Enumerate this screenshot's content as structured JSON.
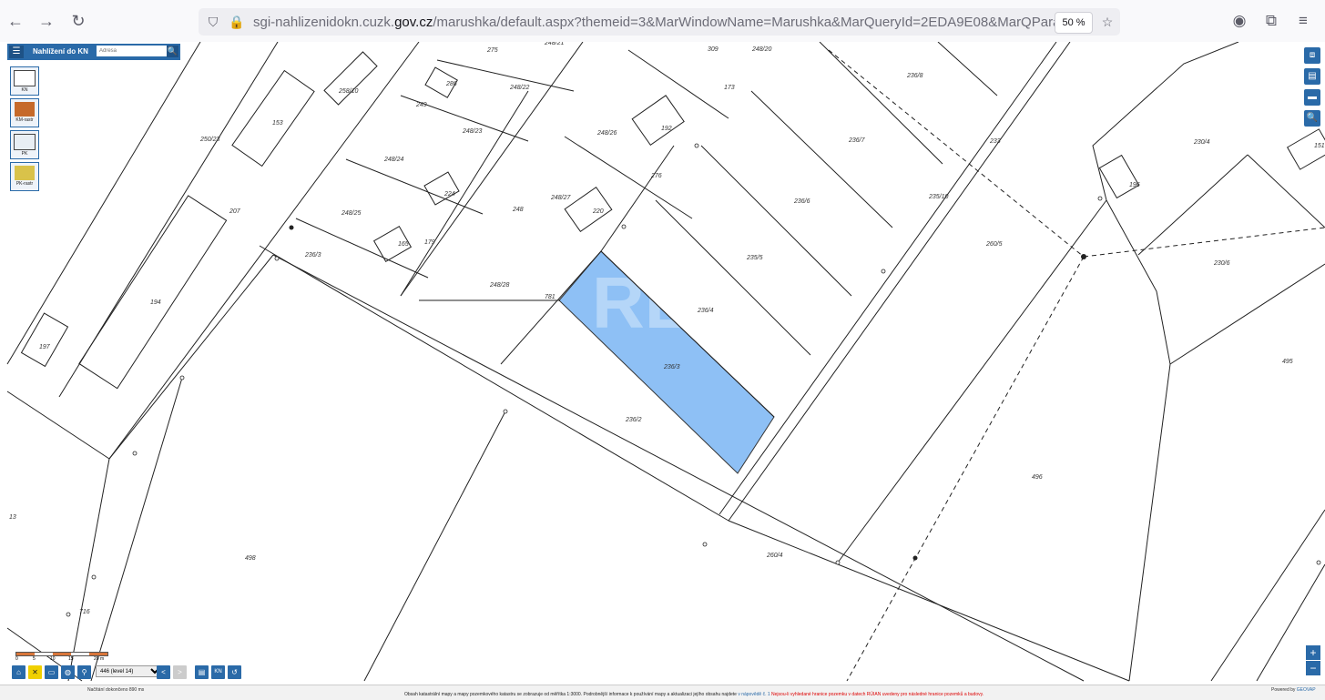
{
  "browser": {
    "url_prefix": "sgi-nahlizenidokn.cuzk.",
    "url_domain": "gov.cz",
    "url_rest": "/marushka/default.aspx?themeid=3&MarWindowName=Marushka&MarQueryId=2EDA9E08&MarQParam0=2716726",
    "zoom": "50 %",
    "back_icon": "←",
    "forward_icon": "→",
    "reload_icon": "↻",
    "star_icon": "☆",
    "shield_icon": "⛉",
    "lock_icon": "🔒",
    "account_icon": "◉",
    "extensions_icon": "⧉",
    "menu_icon": "≡"
  },
  "app": {
    "title": "Nahlížení do KN",
    "address_placeholder": "Adresa",
    "accent": "#2a6aa8",
    "menu_icon": "☰",
    "search_icon": "🔍",
    "layers": [
      {
        "label": "KN",
        "icon": "map-kn-icon"
      },
      {
        "label": "KM-rastr",
        "icon": "raster-icon"
      },
      {
        "label": "PK",
        "icon": "pk-icon"
      },
      {
        "label": "PK-rastr",
        "icon": "pk-raster-icon"
      }
    ],
    "right_tools": [
      "⧈",
      "▤",
      "▬",
      "🔍"
    ]
  },
  "map": {
    "highlight_color": "#8ec0f5",
    "watermark": "RE",
    "labels": [
      "248/21",
      "275",
      "309",
      "248/20",
      "236/8",
      "258/10",
      "286",
      "248/22",
      "173",
      "249",
      "153",
      "248/23",
      "248/26",
      "192",
      "236/7",
      "233",
      "230/4",
      "151",
      "250/23",
      "248/24",
      "224",
      "276",
      "196",
      "248/27",
      "236/6",
      "207",
      "248",
      "220",
      "235/10",
      "260/5",
      "248/25",
      "165",
      "179",
      "236/3",
      "230/6",
      "194",
      "248/28",
      "781",
      "235/5",
      "236/4",
      "197",
      "236/3",
      "495",
      "236/2",
      "496",
      "498",
      "716",
      "260/4",
      "13"
    ]
  },
  "bottom": {
    "scale_ticks": [
      "0",
      "5",
      "10",
      "15",
      "20 m"
    ],
    "scale_value": "446 (level 14)",
    "load_status": "Načítání dokončeno 890 ms",
    "nav_prev": "<",
    "nav_next": ">",
    "kn_button": "KN",
    "footer_note": "Obsah katastrální mapy a mapy pozemkového katastru se zobrazuje od měřítka 1:3000. Podrobnější informace k používání mapy a aktualizaci jejího obsahu najdete",
    "footer_link": "v nápovědě č. 1",
    "footer_red": "Nejsou-li vyhledané hranice pozemku v datech RÚIAN uvedeny pro následné hranice pozemků a budovy.",
    "powered_label": "Powered by",
    "powered_brand": "GEOVAP",
    "zoom_in": "+",
    "zoom_out": "−"
  }
}
